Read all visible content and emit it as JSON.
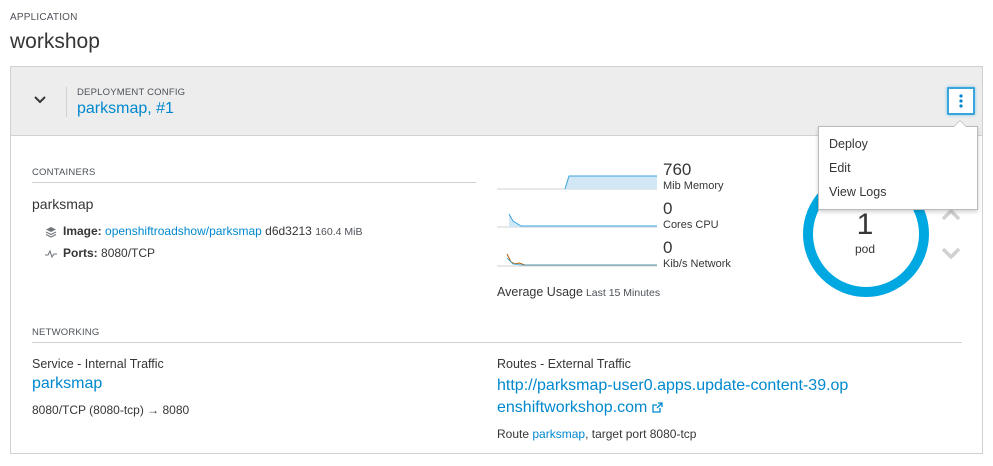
{
  "application": {
    "label": "APPLICATION",
    "name": "workshop"
  },
  "deployment": {
    "label": "DEPLOYMENT CONFIG",
    "name": "parksmap",
    "separator": ",",
    "revision": "#1"
  },
  "actions_menu": {
    "items": [
      "Deploy",
      "Edit",
      "View Logs"
    ]
  },
  "containers": {
    "section_label": "CONTAINERS",
    "name": "parksmap",
    "image_label": "Image:",
    "image_link": "openshiftroadshow/parksmap",
    "image_hash": "d6d3213",
    "image_size": "160.4 MiB",
    "ports_label": "Ports:",
    "ports_value": "8080/TCP"
  },
  "metrics": {
    "memory": {
      "value": "760",
      "unit": "Mib Memory"
    },
    "cpu": {
      "value": "0",
      "unit": "Cores CPU"
    },
    "network": {
      "value": "0",
      "unit": "Kib/s Network"
    },
    "average_label": "Average Usage",
    "average_period": "Last 15 Minutes"
  },
  "pods": {
    "count": "1",
    "label": "pod",
    "ring_color": "#00a8e1"
  },
  "networking": {
    "section_label": "NETWORKING",
    "service_label": "Service - Internal Traffic",
    "service_name": "parksmap",
    "service_ports": "8080/TCP (8080-tcp) → 8080",
    "routes_label": "Routes - External Traffic",
    "route_url": "http://parksmap-user0.apps.update-content-39.openshiftworkshop.com",
    "route_prefix": "Route",
    "route_name": "parksmap",
    "route_suffix": ", target port 8080-tcp"
  },
  "icons": [
    "chevron-down-icon",
    "kebab-icon",
    "layers-icon",
    "pulse-icon",
    "external-link-icon",
    "chevron-up-icon"
  ],
  "colors": {
    "link": "#0088ce",
    "accent": "#00a8e1",
    "chart_fill": "#d1e7f5",
    "network_line": "#b35c00"
  }
}
